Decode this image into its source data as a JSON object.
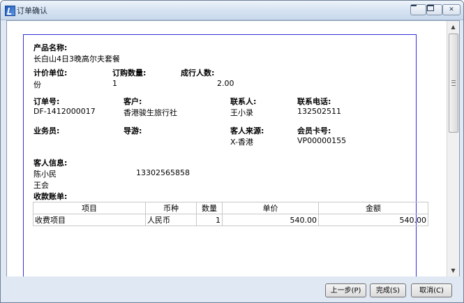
{
  "window": {
    "title": "订单确认"
  },
  "order": {
    "product_label": "产品名称:",
    "product_name": "长白山4日3晚高尔夫套餐",
    "unit_label": "计价单位:",
    "unit_value": "份",
    "qty_label": "订购数量:",
    "qty_value": "1",
    "people_label": "成行人数:",
    "people_value": "2.00",
    "order_no_label": "订单号:",
    "order_no_value": "DF-1412000017",
    "customer_label": "客户:",
    "customer_value": "香港骏生旅行社",
    "contact_label": "联系人:",
    "contact_value": "王小录",
    "phone_label": "联系电话:",
    "phone_value": "132502511",
    "sales_label": "业务员:",
    "guide_label": "导游:",
    "source_label": "客人来源:",
    "source_value": "X-香港",
    "member_label": "会员卡号:",
    "member_value": "VP00000155",
    "guest_info_label": "客人信息:",
    "guests": [
      {
        "name": "陈小民",
        "phone": "13302565858"
      },
      {
        "name": "王会",
        "phone": ""
      }
    ],
    "bill_label": "收款账单:",
    "bill_headers": [
      "项目",
      "币种",
      "数量",
      "单价",
      "金额"
    ],
    "bill_rows": [
      [
        "收费项目",
        "人民币",
        "1",
        "540.00",
        "540.00"
      ]
    ]
  },
  "buttons": {
    "prev": "上一步(P)",
    "finish": "完成(S)",
    "cancel": "取消(C)"
  }
}
